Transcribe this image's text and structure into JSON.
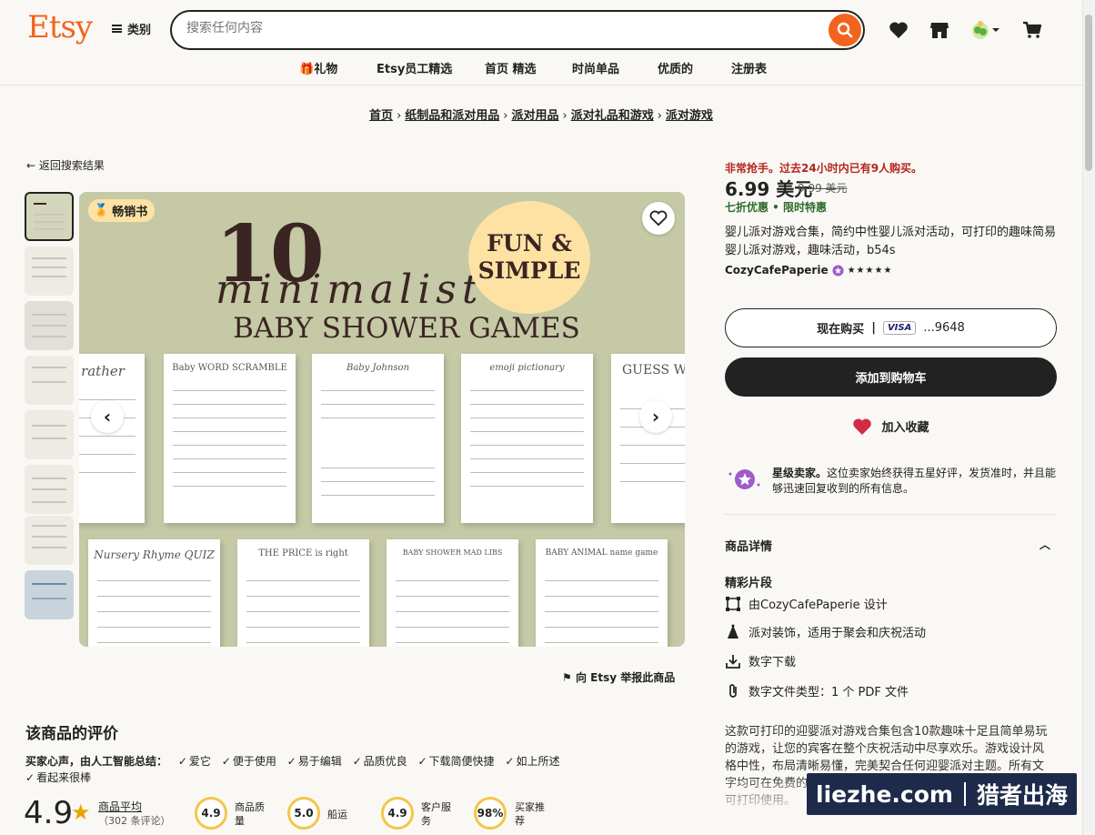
{
  "header": {
    "logo": "Etsy",
    "categories": "类别",
    "search_placeholder": "搜索任何内容",
    "nav": [
      "礼物",
      "Etsy员工精选",
      "首页 精选",
      "时尚单品",
      "优质的",
      "注册表"
    ]
  },
  "breadcrumb": [
    "首页",
    "纸制品和派对用品",
    "派对用品",
    "派对礼品和游戏",
    "派对游戏"
  ],
  "back_label": "返回搜索结果",
  "image": {
    "badge": "畅销书",
    "big_number": "10",
    "script_word": "minimalist",
    "headline": "BABY SHOWER GAMES",
    "circle_line1": "FUN &",
    "circle_line2": "SIMPLE",
    "papers": [
      "rather",
      "Baby WORD SCRAMBLE",
      "Baby Johnson",
      "emoji pictionary",
      "GUESS W",
      "Nursery Rhyme QUIZ",
      "THE PRICE is right",
      "BABY SHOWER MAD LIBS",
      "BABY ANIMAL name game"
    ]
  },
  "report_label": "向 Etsy 举报此商品",
  "reviews": {
    "title": "该商品的评价",
    "summary_label": "买家心声，由人工智能总结：",
    "tags": [
      "爱它",
      "便于使用",
      "易于编辑",
      "品质优良",
      "下载简便快捷",
      "如上所述",
      "看起来很棒"
    ],
    "score": "4.9",
    "avg_label": "商品平均",
    "count": "（302 条评论）",
    "metrics": [
      {
        "value": "4.9",
        "label_1": "商品质",
        "label_2": "量"
      },
      {
        "value": "5.0",
        "label_1": "船运",
        "label_2": ""
      },
      {
        "value": "4.9",
        "label_1": "客户服",
        "label_2": "务"
      },
      {
        "value": "98%",
        "label_1": "买家推",
        "label_2": "荐"
      }
    ]
  },
  "product": {
    "urgency": "非常抢手。过去24小时内已有9人购买。",
    "price": "6.99 美元",
    "original_price": "9.99 美元",
    "sale": "七折优惠 • 限时特惠",
    "title": "婴儿派对游戏合集，简约中性婴儿派对活动，可打印的趣味简易婴儿派对游戏，趣味活动，b54s",
    "shop": "CozyCafePaperie",
    "stars": "★★★★★",
    "buy_now": "现在购买",
    "card_brand": "VISA",
    "card_last": "...9648",
    "add_to_cart": "添加到购物车",
    "add_fav": "加入收藏",
    "star_seller_bold": "星级卖家。",
    "star_seller_text": "这位卖家始终获得五星好评，发货准时，并且能够迅速回复收到的所有信息。",
    "details_heading": "商品详情",
    "highlights_heading": "精彩片段",
    "features": [
      "由CozyCafePaperie 设计",
      "派对装饰，适用于聚会和庆祝活动",
      "数字下载",
      "数字文件类型：1 个 PDF 文件"
    ],
    "description": "这款可打印的迎婴派对游戏合集包含10款趣味十足且简单易玩的游戏，让您的宾客在整个庆祝活动中尽享欢乐。游戏设计风格中性，布局清晰易懂，完美契合任何迎婴派对主题。所有文字均可在免费的 Canva 中编辑（需免费账户！），一键下载即可打印使用。"
  },
  "watermark": {
    "left": "liezhe.com",
    "right": "猎者出海"
  },
  "colors": {
    "brand": "#f1641e",
    "sale": "#2d6a2b",
    "urgent": "#b3261e",
    "hero_bg": "#c5c9a6",
    "circle": "#fde2a4"
  }
}
